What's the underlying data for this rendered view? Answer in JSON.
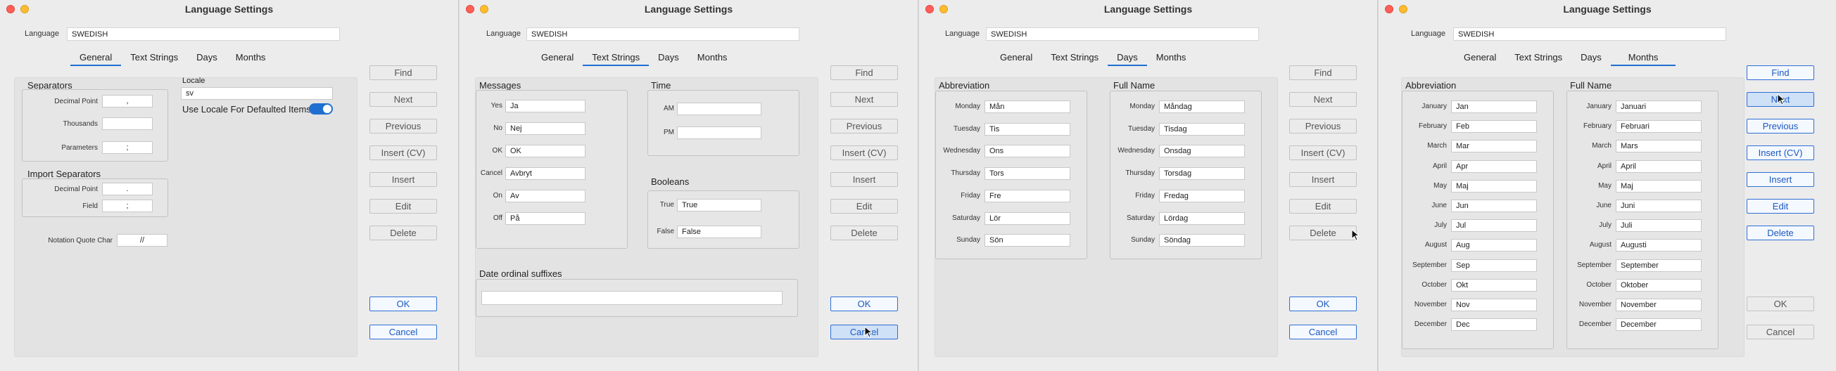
{
  "title": "Language Settings",
  "language_label": "Language",
  "language_value": "SWEDISH",
  "tabs": [
    "General",
    "Text Strings",
    "Days",
    "Months"
  ],
  "buttons": {
    "find": "Find",
    "next": "Next",
    "previous": "Previous",
    "insert_cv": "Insert (CV)",
    "insert": "Insert",
    "edit": "Edit",
    "delete": "Delete",
    "ok": "OK",
    "cancel": "Cancel"
  },
  "general": {
    "separators_title": "Separators",
    "decimal_point_label": "Decimal Point",
    "decimal_point_value": ",",
    "thousands_label": "Thousands",
    "thousands_value": "",
    "parameters_label": "Parameters",
    "parameters_value": ";",
    "import_title": "Import Separators",
    "import_decimal_label": "Decimal Point",
    "import_decimal_value": ".",
    "field_label": "Field",
    "field_value": ";",
    "notation_label": "Notation Quote Char",
    "notation_value": "//",
    "locale_label": "Locale",
    "locale_value": "sv",
    "use_locale_label": "Use Locale For Defaulted Items"
  },
  "text_strings": {
    "messages_title": "Messages",
    "messages": [
      {
        "label": "Yes",
        "value": "Ja"
      },
      {
        "label": "No",
        "value": "Nej"
      },
      {
        "label": "OK",
        "value": "OK"
      },
      {
        "label": "Cancel",
        "value": "Avbryt"
      },
      {
        "label": "On",
        "value": "Av"
      },
      {
        "label": "Off",
        "value": "På"
      }
    ],
    "time_title": "Time",
    "am_label": "AM",
    "am_value": "",
    "pm_label": "PM",
    "pm_value": "",
    "booleans_title": "Booleans",
    "true_label": "True",
    "true_value": "True",
    "false_label": "False",
    "false_value": "False",
    "date_ordinal_title": "Date ordinal suffixes",
    "date_ordinal_value": ""
  },
  "days": {
    "abbr_title": "Abbreviation",
    "full_title": "Full Name",
    "labels": [
      "Monday",
      "Tuesday",
      "Wednesday",
      "Thursday",
      "Friday",
      "Saturday",
      "Sunday"
    ],
    "abbr": [
      "Mån",
      "Tis",
      "Ons",
      "Tors",
      "Fre",
      "Lör",
      "Sön"
    ],
    "full": [
      "Måndag",
      "Tisdag",
      "Onsdag",
      "Torsdag",
      "Fredag",
      "Lördag",
      "Söndag"
    ]
  },
  "months": {
    "abbr_title": "Abbreviation",
    "full_title": "Full Name",
    "labels": [
      "January",
      "February",
      "March",
      "April",
      "May",
      "June",
      "July",
      "August",
      "September",
      "October",
      "November",
      "December"
    ],
    "abbr": [
      "Jan",
      "Feb",
      "Mar",
      "Apr",
      "Maj",
      "Jun",
      "Jul",
      "Aug",
      "Sep",
      "Okt",
      "Nov",
      "Dec"
    ],
    "full": [
      "Januari",
      "Februari",
      "Mars",
      "April",
      "Maj",
      "Juni",
      "Juli",
      "Augusti",
      "September",
      "Oktober",
      "November",
      "December"
    ]
  }
}
